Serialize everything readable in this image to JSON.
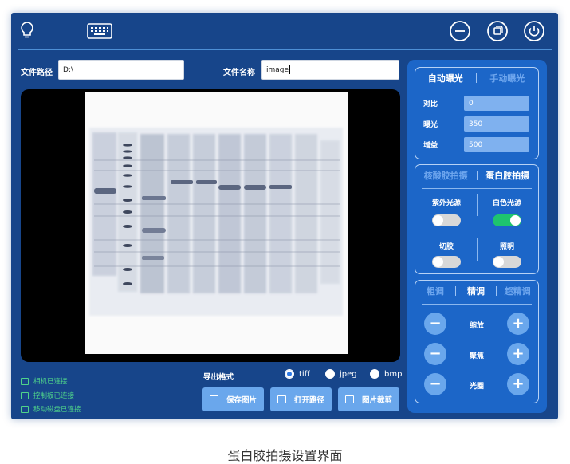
{
  "toolbar": {
    "bulb_icon": "lightbulb-icon",
    "keyboard_icon": "keyboard-icon",
    "minimize_icon": "minimize-icon",
    "restore_icon": "restore-icon",
    "power_icon": "power-icon"
  },
  "file": {
    "path_label": "文件路径",
    "path_value": "D:\\",
    "name_label": "文件名称",
    "name_value": "image"
  },
  "status": [
    {
      "text": "相机已连接",
      "icon": "camera-icon"
    },
    {
      "text": "控制板已连接",
      "icon": "board-icon"
    },
    {
      "text": "移动磁盘已连接",
      "icon": "disk-icon"
    }
  ],
  "export": {
    "label": "导出格式",
    "options": [
      {
        "label": "tiff",
        "selected": true
      },
      {
        "label": "jpeg",
        "selected": false
      },
      {
        "label": "bmp",
        "selected": false
      }
    ]
  },
  "actions": [
    {
      "label": "保存图片",
      "icon": "image-icon"
    },
    {
      "label": "打开路径",
      "icon": "folder-icon"
    },
    {
      "label": "图片裁剪",
      "icon": "crop-icon"
    }
  ],
  "exposure": {
    "tab_auto": "自动曝光",
    "tab_manual": "手动曝光",
    "contrast_label": "对比",
    "contrast_value": "0",
    "exposure_label": "曝光",
    "exposure_value": "350",
    "gain_label": "增益",
    "gain_value": "500"
  },
  "capture": {
    "tab_nucleic": "核酸胶拍摄",
    "tab_protein": "蛋白胶拍摄",
    "uv_label": "紫外光源",
    "uv_on": false,
    "white_label": "白色光源",
    "white_on": true,
    "cut_label": "切胶",
    "cut_on": false,
    "light_label": "照明",
    "light_on": false
  },
  "tuning": {
    "tab_coarse": "粗调",
    "tab_fine": "精调",
    "tab_ultra": "超精调",
    "zoom_label": "缩放",
    "focus_label": "聚焦",
    "aperture_label": "光圈",
    "minus": "−",
    "plus": "+"
  },
  "caption": "蛋白胶拍摄设置界面",
  "colors": {
    "window_bg": "#17458a",
    "panel_bg": "#1c66c8",
    "accent": "#6aa7ec",
    "status_green": "#4fd38a",
    "toggle_on": "#1ec46e"
  }
}
